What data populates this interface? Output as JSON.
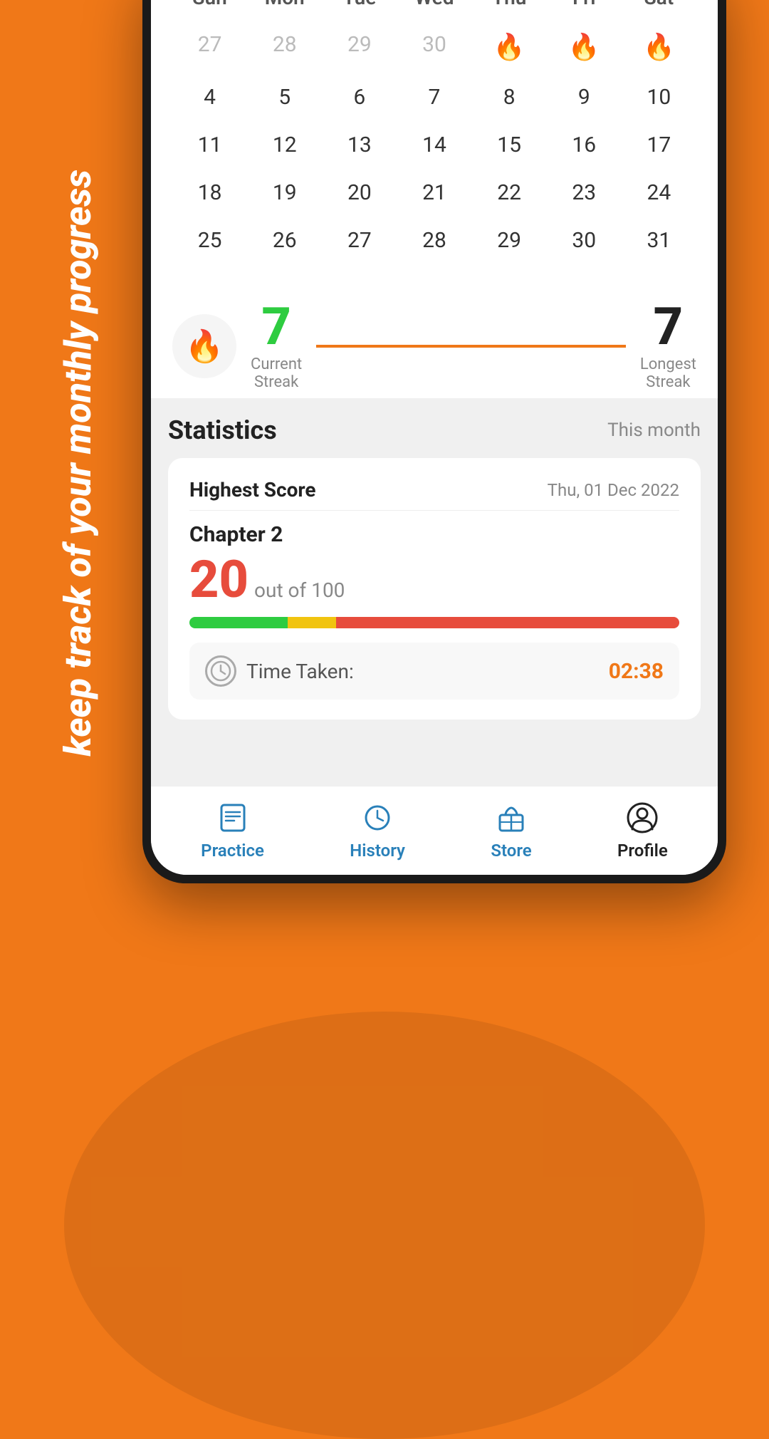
{
  "background": {
    "color": "#F07818"
  },
  "side_text": "keep track of your monthly progress",
  "calendar": {
    "headers": [
      "Sun",
      "Mon",
      "Tue",
      "Wed",
      "Thu",
      "Fri",
      "Sat"
    ],
    "rows": [
      [
        {
          "day": "27",
          "greyed": true,
          "flame": false
        },
        {
          "day": "28",
          "greyed": true,
          "flame": false
        },
        {
          "day": "29",
          "greyed": true,
          "flame": false
        },
        {
          "day": "30",
          "greyed": true,
          "flame": false
        },
        {
          "day": "",
          "greyed": false,
          "flame": true
        },
        {
          "day": "",
          "greyed": false,
          "flame": true
        },
        {
          "day": "",
          "greyed": false,
          "flame": true
        }
      ],
      [
        {
          "day": "4",
          "greyed": false,
          "flame": false
        },
        {
          "day": "5",
          "greyed": false,
          "flame": false
        },
        {
          "day": "6",
          "greyed": false,
          "flame": false
        },
        {
          "day": "7",
          "greyed": false,
          "flame": false
        },
        {
          "day": "8",
          "greyed": false,
          "flame": false
        },
        {
          "day": "9",
          "greyed": false,
          "flame": false
        },
        {
          "day": "10",
          "greyed": false,
          "flame": false
        }
      ],
      [
        {
          "day": "11",
          "greyed": false,
          "flame": false
        },
        {
          "day": "12",
          "greyed": false,
          "flame": false
        },
        {
          "day": "13",
          "greyed": false,
          "flame": false
        },
        {
          "day": "14",
          "greyed": false,
          "flame": false
        },
        {
          "day": "15",
          "greyed": false,
          "flame": false
        },
        {
          "day": "16",
          "greyed": false,
          "flame": false
        },
        {
          "day": "17",
          "greyed": false,
          "flame": false
        }
      ],
      [
        {
          "day": "18",
          "greyed": false,
          "flame": false
        },
        {
          "day": "19",
          "greyed": false,
          "flame": false
        },
        {
          "day": "20",
          "greyed": false,
          "flame": false
        },
        {
          "day": "21",
          "greyed": false,
          "flame": false
        },
        {
          "day": "22",
          "greyed": false,
          "flame": false
        },
        {
          "day": "23",
          "greyed": false,
          "flame": false
        },
        {
          "day": "24",
          "greyed": false,
          "flame": false
        }
      ],
      [
        {
          "day": "25",
          "greyed": false,
          "flame": false
        },
        {
          "day": "26",
          "greyed": false,
          "flame": false
        },
        {
          "day": "27",
          "greyed": false,
          "flame": false
        },
        {
          "day": "28",
          "greyed": false,
          "flame": false
        },
        {
          "day": "29",
          "greyed": false,
          "flame": false
        },
        {
          "day": "30",
          "greyed": false,
          "flame": false
        },
        {
          "day": "31",
          "greyed": false,
          "flame": false
        }
      ]
    ]
  },
  "streak": {
    "current": "7",
    "current_label": "Current\nStreak",
    "longest": "7",
    "longest_label": "Longest\nStreak"
  },
  "statistics": {
    "title": "Statistics",
    "filter": "This month",
    "card": {
      "score_title": "Highest Score",
      "score_date": "Thu, 01 Dec 2022",
      "chapter": "Chapter 2",
      "score": "20",
      "out_of": "out of 100",
      "time_label": "Time Taken:",
      "time_value": "02:38"
    }
  },
  "nav": {
    "items": [
      {
        "label": "Practice",
        "active": false,
        "icon": "practice-icon"
      },
      {
        "label": "History",
        "active": false,
        "icon": "history-icon"
      },
      {
        "label": "Store",
        "active": false,
        "icon": "store-icon"
      },
      {
        "label": "Profile",
        "active": true,
        "icon": "profile-icon"
      }
    ]
  }
}
